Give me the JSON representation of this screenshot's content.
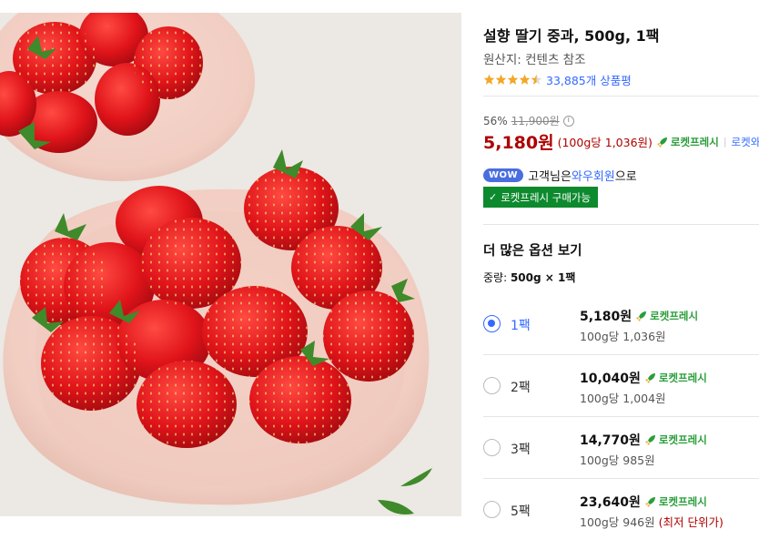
{
  "product": {
    "title": "설향 딸기 중과, 500g, 1팩",
    "origin": "원산지: 컨텐츠 참조",
    "rating": 4.5,
    "review_count": "33,885개 상품평"
  },
  "pricing": {
    "discount_rate": "56%",
    "original_price": "11,900원",
    "info_icon": "ⓘ",
    "sale_price": "5,180원",
    "unit_price": "(100g당 1,036원)",
    "rocket_label": "로켓프레시",
    "separator": "|",
    "rocket_overseas": "로켓와"
  },
  "membership": {
    "wow_badge": "WOW",
    "text_before": "고객님은 ",
    "link": "와우회원",
    "text_after": "으로",
    "fresh_buy": "로켓프레시 구매가능",
    "check_icon": "✓"
  },
  "options": {
    "heading": "더 많은 옵션 보기",
    "weight_label": "중량: ",
    "weight_value": "500g × 1팩",
    "items": [
      {
        "name": "1팩",
        "price": "5,180원",
        "rocket": "로켓프레시",
        "unit": "100g당 1,036원",
        "note": "",
        "selected": true
      },
      {
        "name": "2팩",
        "price": "10,040원",
        "rocket": "로켓프레시",
        "unit": "100g당 1,004원",
        "note": "",
        "selected": false
      },
      {
        "name": "3팩",
        "price": "14,770원",
        "rocket": "로켓프레시",
        "unit": "100g당 985원",
        "note": "",
        "selected": false
      },
      {
        "name": "5팩",
        "price": "23,640원",
        "rocket": "로켓프레시",
        "unit": "100g당 946원",
        "note": "(최저 단위가)",
        "selected": false
      }
    ]
  },
  "colors": {
    "price_red": "#ae0000",
    "link_blue": "#346aff",
    "rocket_green": "#2a9e3a",
    "fresh_button": "#0d8a2e",
    "star_orange": "#f5a623"
  }
}
